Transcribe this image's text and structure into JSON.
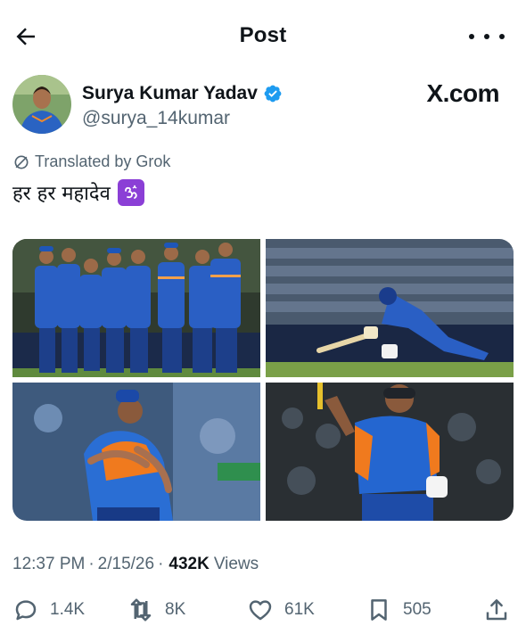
{
  "header": {
    "title": "Post"
  },
  "author": {
    "name": "Surya Kumar Yadav",
    "handle": "@surya_14kumar",
    "verified": true
  },
  "source_watermark": "X.com",
  "translation": {
    "label": "Translated by Grok"
  },
  "post": {
    "text": "हर हर महादेव",
    "emoji_icon": "om-symbol-icon"
  },
  "media": {
    "count": 4
  },
  "meta": {
    "time": "12:37 PM",
    "date": "2/15/26",
    "separator": "·",
    "views_count": "432K",
    "views_label": "Views"
  },
  "actions": {
    "replies": "1.4K",
    "reposts": "8K",
    "likes": "61K",
    "bookmarks": "505"
  },
  "colors": {
    "text": "#0f1419",
    "secondary": "#536471",
    "verified": "#1d9bf0",
    "om_badge": "#8b3fd6",
    "jersey": "#1f5fbf"
  }
}
